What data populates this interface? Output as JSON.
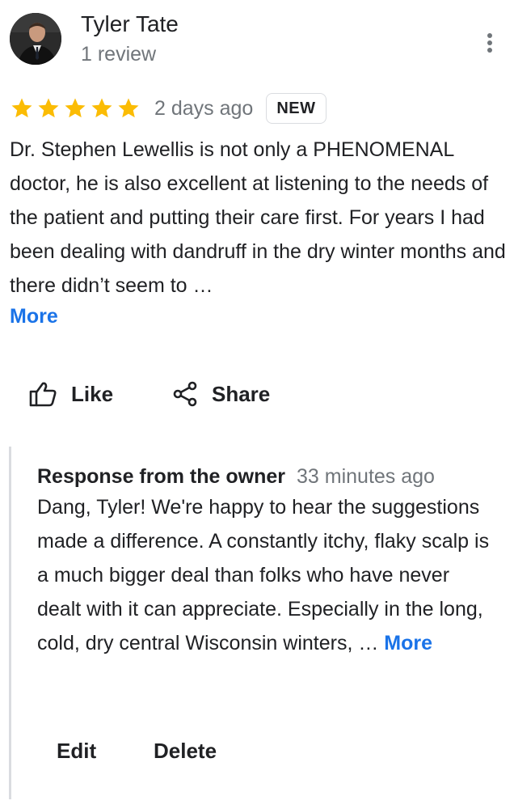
{
  "reviewer": {
    "name": "Tyler Tate",
    "review_count": "1 review"
  },
  "review": {
    "rating": 5,
    "max_rating": 5,
    "time": "2 days ago",
    "badge": "NEW",
    "text": "Dr. Stephen Lewellis is not only a PHENOMENAL doctor, he is also excellent at listening to the needs of the patient and putting their care first. For years I had been dealing with dandruff in the dry winter months and there didn’t seem to …",
    "more_label": "More"
  },
  "actions": {
    "like_label": "Like",
    "share_label": "Share"
  },
  "owner_response": {
    "title": "Response from the owner",
    "time": "33 minutes ago",
    "text": "Dang, Tyler! We're happy to hear the suggestions made a difference. A constantly itchy, flaky scalp is a much bigger deal than folks who have never dealt with it can appreciate. Especially in the long, cold, dry central Wisconsin winters, … ",
    "more_label": "More",
    "edit_label": "Edit",
    "delete_label": "Delete"
  },
  "icons": {
    "avatar": "profile-photo",
    "menu": "more-vert-icon",
    "star": "star-icon",
    "like": "thumbs-up-icon",
    "share": "share-icon"
  },
  "colors": {
    "star": "#fbbc04",
    "link": "#1a73e8",
    "secondary_text": "#70757a",
    "divider": "#dadce0"
  }
}
